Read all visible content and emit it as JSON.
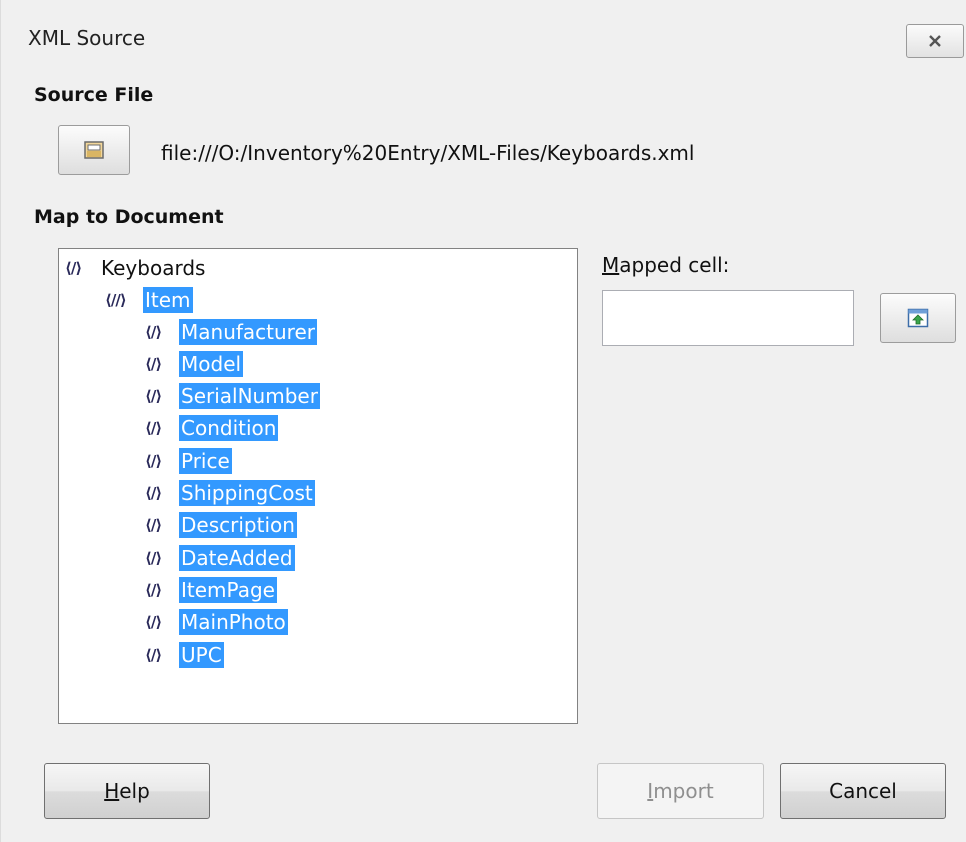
{
  "window": {
    "title": "XML Source"
  },
  "source_file": {
    "heading": "Source File",
    "path": "file:///O:/Inventory%20Entry/XML-Files/Keyboards.xml"
  },
  "map": {
    "heading": "Map to Document",
    "tree": {
      "root": "Keyboards",
      "item": "Item",
      "children": [
        "Manufacturer",
        "Model",
        "SerialNumber",
        "Condition",
        "Price",
        "ShippingCost",
        "Description",
        "DateAdded",
        "ItemPage",
        "MainPhoto",
        "UPC"
      ]
    },
    "mapped_cell": {
      "label_first": "M",
      "label_rest": "apped cell:",
      "value": ""
    }
  },
  "buttons": {
    "help": {
      "accel": "H",
      "rest": "elp"
    },
    "import": {
      "accel": "I",
      "rest": "mport"
    },
    "cancel": "Cancel"
  },
  "colors": {
    "selection": "#3399ff",
    "dialog_bg": "#f0f0f0"
  },
  "icons": {
    "close": "close-icon",
    "browse": "folder-icon",
    "pick": "select-cell-icon",
    "tag": "xml-element-icon"
  }
}
